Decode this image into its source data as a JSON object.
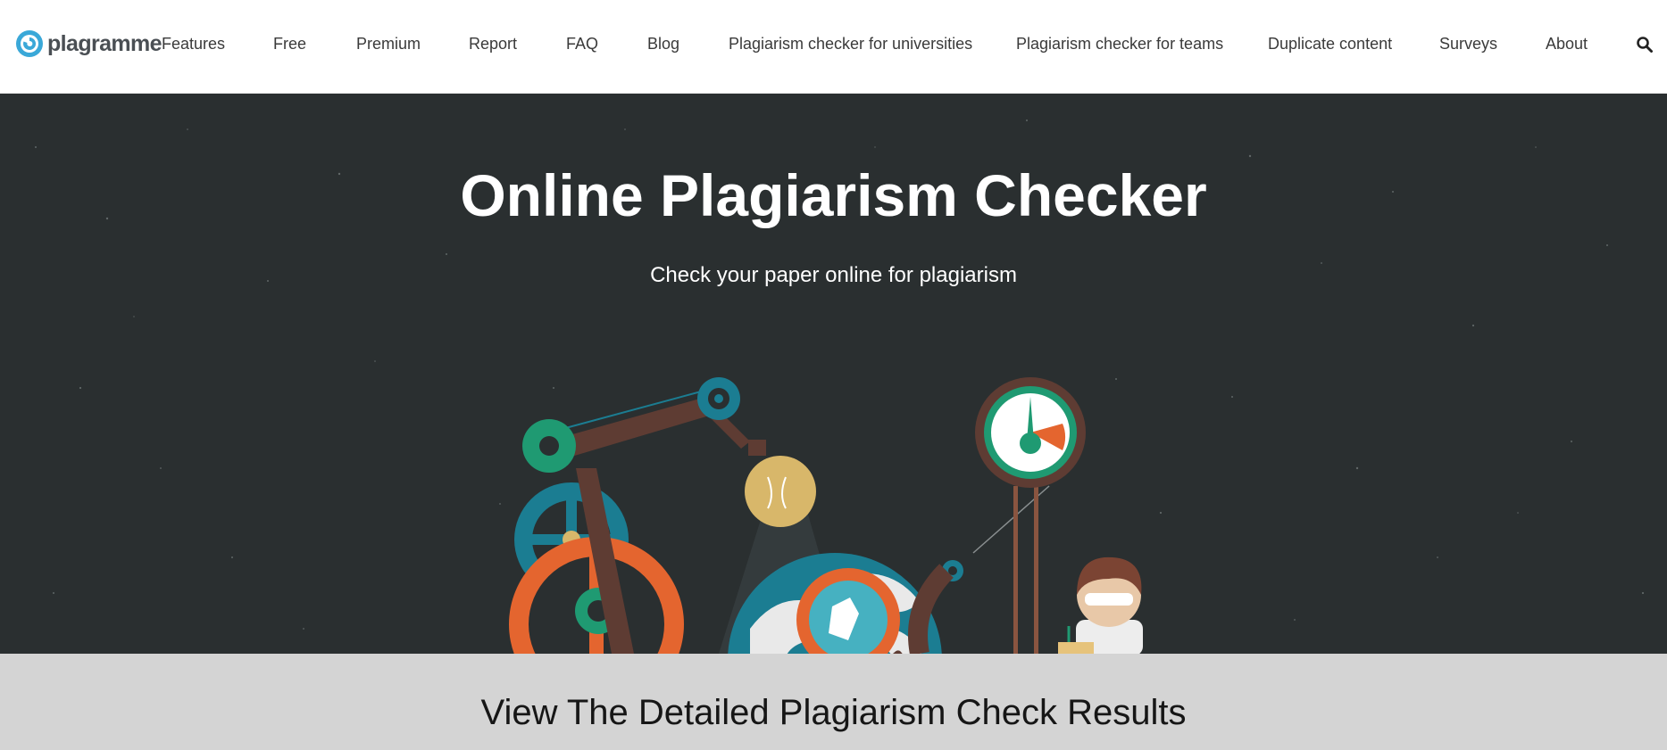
{
  "brand": {
    "name": "plagramme",
    "accent": "#3aa8d8"
  },
  "nav": {
    "items": [
      {
        "label": "Features"
      },
      {
        "label": "Free"
      },
      {
        "label": "Premium"
      },
      {
        "label": "Report"
      },
      {
        "label": "FAQ"
      },
      {
        "label": "Blog"
      },
      {
        "label": "Plagiarism checker for universities"
      },
      {
        "label": "Plagiarism checker for teams"
      },
      {
        "label": "Duplicate content"
      },
      {
        "label": "Surveys"
      },
      {
        "label": "About"
      }
    ],
    "search_icon": "search-icon"
  },
  "hero": {
    "title": "Online Plagiarism Checker",
    "subtitle": "Check your paper online for plagiarism",
    "background": "#2a2f30"
  },
  "results": {
    "title": "View The Detailed Plagiarism Check Results",
    "background": "#d4d4d4"
  },
  "colors": {
    "teal": "#1b7d92",
    "green": "#1f9a72",
    "orange": "#e4652f",
    "brown": "#5e3c33",
    "bulb": "#d8b76a"
  }
}
